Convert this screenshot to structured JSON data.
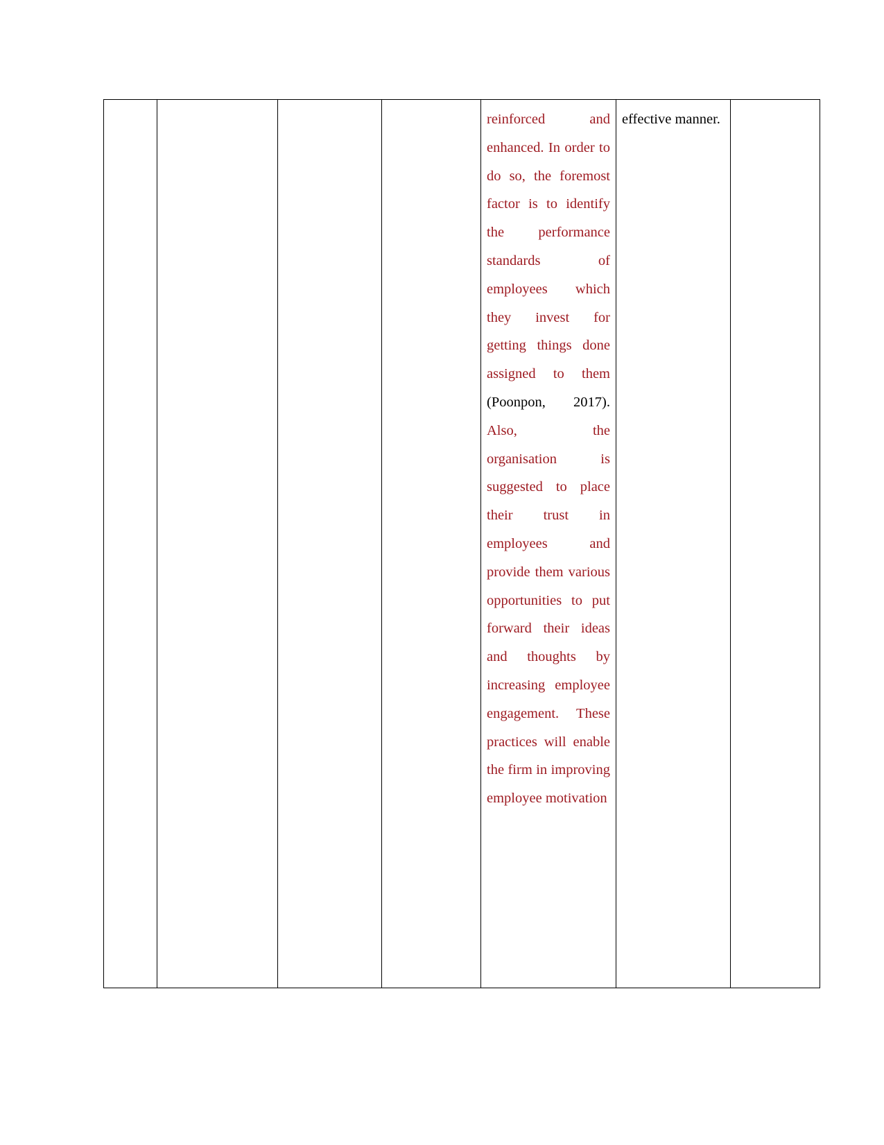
{
  "document": {
    "page_background": "#ffffff",
    "text_color_primary": "#9e1b22",
    "text_color_secondary": "#000000"
  },
  "table": {
    "name": "recommendations-table-continued",
    "column_count": 7,
    "row_count": 1,
    "columns": [
      {
        "id": "col-1",
        "label": "",
        "content": ""
      },
      {
        "id": "col-2",
        "label": "",
        "content": ""
      },
      {
        "id": "col-3",
        "label": "",
        "content": ""
      },
      {
        "id": "col-4",
        "label": "",
        "content": ""
      },
      {
        "id": "col-5",
        "label": "",
        "content": "continuation-text"
      },
      {
        "id": "col-6",
        "label": "",
        "content": "effective manner."
      },
      {
        "id": "col-7",
        "label": "",
        "content": ""
      }
    ],
    "rows": [
      {
        "cells": {
          "c1": "",
          "c2": "",
          "c3": "",
          "c4": "",
          "c5_part1": "reinforced and enhanced. In order to do so, the foremost factor is to identify the performance standards of employees which they invest for getting things done assigned to them ",
          "c5_citation": "(Poonpon, 2017).",
          "c5_part2": " Also, the organisation is suggested to place their trust in employees and provide them various opportunities to put forward their ideas and thoughts by increasing employee engagement. These practices will enable the firm in improving employee motivation",
          "c6": "effective manner.",
          "c7": ""
        }
      }
    ]
  }
}
